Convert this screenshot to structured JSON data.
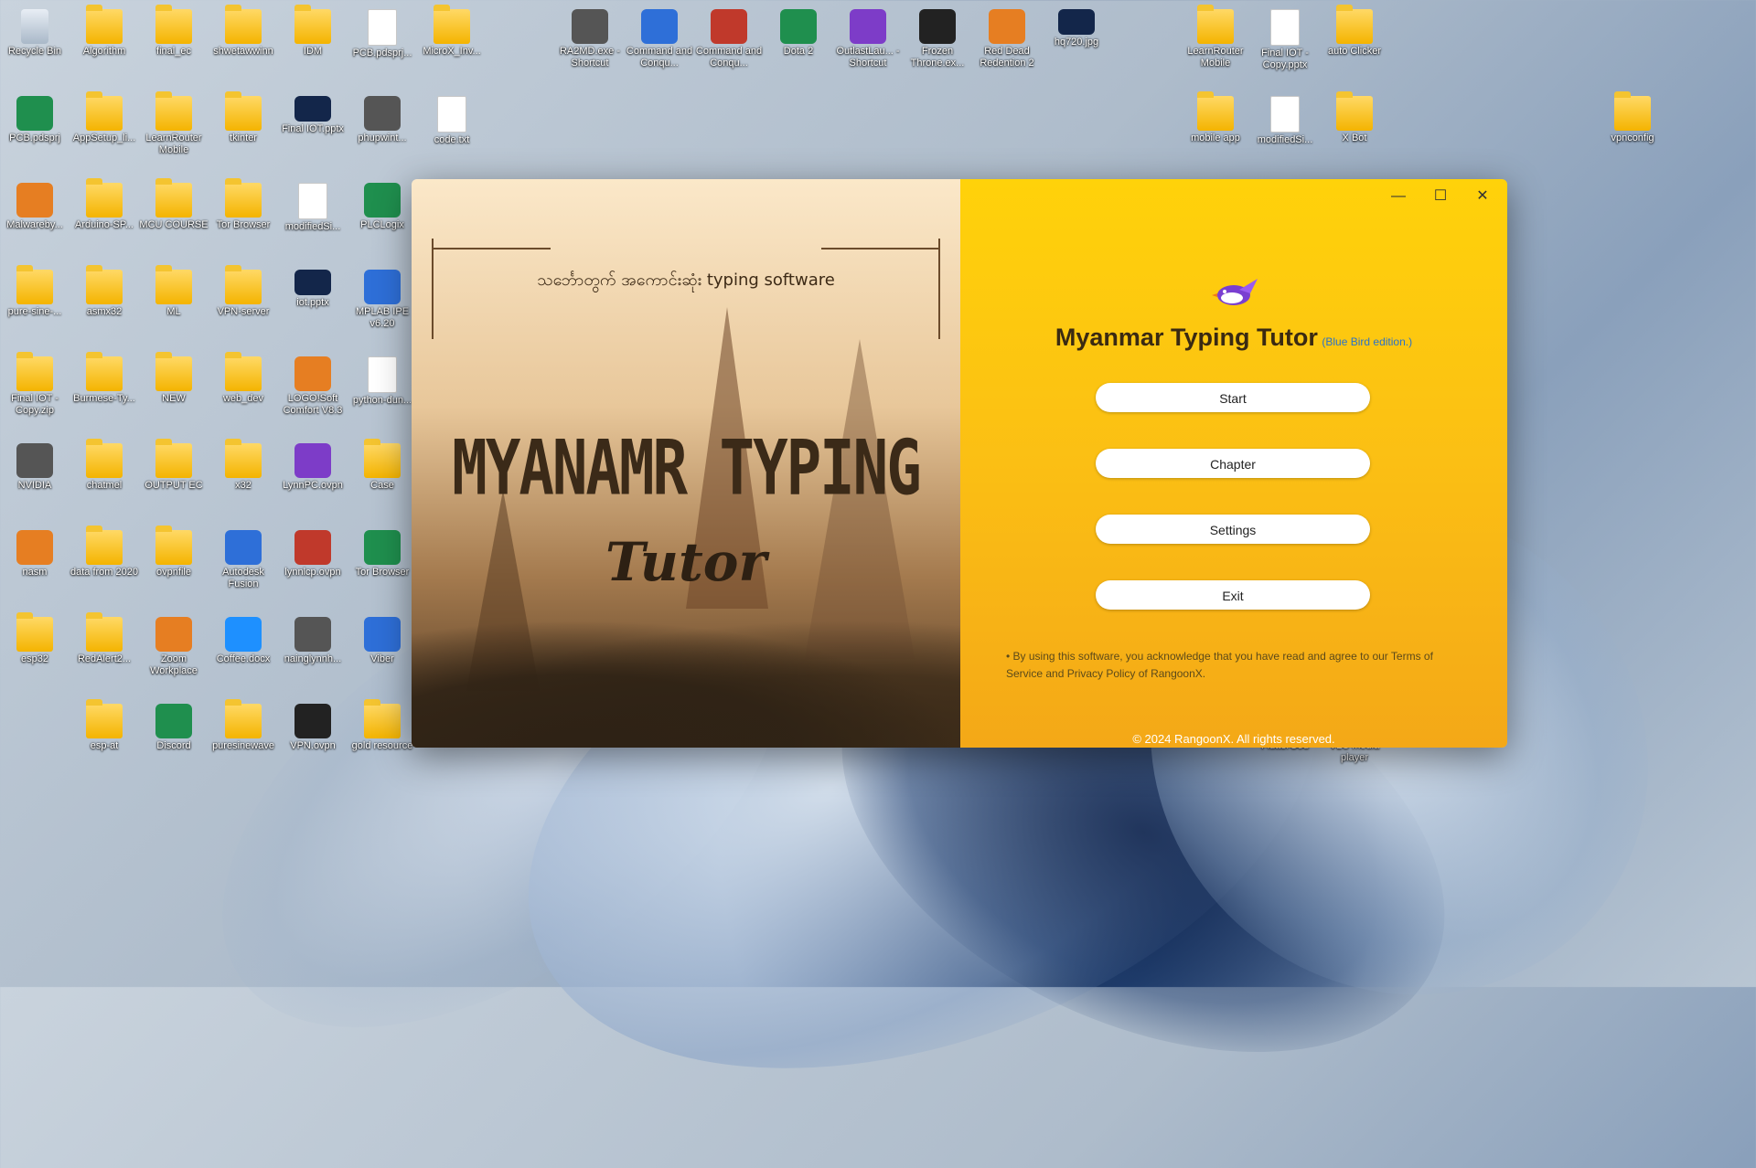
{
  "desktop": {
    "icons": [
      {
        "label": "Recycle Bin",
        "icon": "recycle-bin-icon"
      },
      {
        "label": "Algorithm",
        "icon": "folder-icon"
      },
      {
        "label": "final_ec",
        "icon": "folder-icon"
      },
      {
        "label": "shwetawwinn",
        "icon": "folder-icon"
      },
      {
        "label": "IDM",
        "icon": "folder-icon"
      },
      {
        "label": "PCB.pdsprj...",
        "icon": "file-icon"
      },
      {
        "label": "MicroX_Inv...",
        "icon": "folder-icon"
      },
      {
        "label": "RA2MD.exe - Shortcut",
        "icon": "app-icon"
      },
      {
        "label": "Command and Conqu...",
        "icon": "app-icon"
      },
      {
        "label": "Command and Conqu...",
        "icon": "app-icon"
      },
      {
        "label": "Dota 2",
        "icon": "app-icon"
      },
      {
        "label": "OutlastLau... - Shortcut",
        "icon": "app-icon"
      },
      {
        "label": "Frozen Throne.ex...",
        "icon": "app-icon"
      },
      {
        "label": "Red Dead Redention 2",
        "icon": "app-icon"
      },
      {
        "label": "hq720.jpg",
        "icon": "image-icon"
      },
      {
        "label": "LearnRouter Mobile",
        "icon": "folder-icon"
      },
      {
        "label": "Final IOT - Copy.pptx",
        "icon": "file-icon"
      },
      {
        "label": "auto Clicker",
        "icon": "folder-icon"
      },
      {
        "label": "PCB.pdsprj",
        "icon": "app-icon"
      },
      {
        "label": "AppSetup_li...",
        "icon": "folder-icon"
      },
      {
        "label": "LearnRouter Mobile",
        "icon": "folder-icon"
      },
      {
        "label": "tkinter",
        "icon": "folder-icon"
      },
      {
        "label": "Final IOT.pptx",
        "icon": "image-icon"
      },
      {
        "label": "phupwint...",
        "icon": "app-icon"
      },
      {
        "label": "code.txt",
        "icon": "file-icon"
      },
      {
        "label": "mobile app",
        "icon": "folder-icon"
      },
      {
        "label": "modifiedSi...",
        "icon": "file-icon"
      },
      {
        "label": "X Bot",
        "icon": "folder-icon"
      },
      {
        "label": "vpnconfig",
        "icon": "folder-icon"
      },
      {
        "label": "Malwareby...",
        "icon": "app-icon"
      },
      {
        "label": "Arduino-SP...",
        "icon": "folder-icon"
      },
      {
        "label": "MCU COURSE",
        "icon": "folder-icon"
      },
      {
        "label": "Tor Browser",
        "icon": "folder-icon"
      },
      {
        "label": "modifiedSi...",
        "icon": "file-icon"
      },
      {
        "label": "PLCLogix",
        "icon": "app-icon"
      },
      {
        "label": "pure-sine-...",
        "icon": "folder-icon"
      },
      {
        "label": "asmx32",
        "icon": "folder-icon"
      },
      {
        "label": "ML",
        "icon": "folder-icon"
      },
      {
        "label": "VPN-server",
        "icon": "folder-icon"
      },
      {
        "label": "iot.pptx",
        "icon": "image-icon"
      },
      {
        "label": "MPLAB IPE v6.20",
        "icon": "app-icon"
      },
      {
        "label": "Final IOT - Copy.zip",
        "icon": "folder-icon"
      },
      {
        "label": "Burmese-Ty...",
        "icon": "folder-icon"
      },
      {
        "label": "NEW",
        "icon": "folder-icon"
      },
      {
        "label": "web_dev",
        "icon": "folder-icon"
      },
      {
        "label": "LOGO!Soft Comfort V8.3",
        "icon": "app-icon"
      },
      {
        "label": "python-dun...",
        "icon": "file-icon"
      },
      {
        "label": "NVIDIA",
        "icon": "app-icon"
      },
      {
        "label": "chatmel",
        "icon": "folder-icon"
      },
      {
        "label": "OUTPUT EC",
        "icon": "folder-icon"
      },
      {
        "label": "x32",
        "icon": "folder-icon"
      },
      {
        "label": "LynnPC.ovpn",
        "icon": "app-icon"
      },
      {
        "label": "Case",
        "icon": "folder-icon"
      },
      {
        "label": "nasm",
        "icon": "app-icon"
      },
      {
        "label": "data from 2020",
        "icon": "folder-icon"
      },
      {
        "label": "ovpnfile",
        "icon": "folder-icon"
      },
      {
        "label": "Autodesk Fusion",
        "icon": "app-icon"
      },
      {
        "label": "lynnlcp.ovpn",
        "icon": "app-icon"
      },
      {
        "label": "Tor Browser",
        "icon": "app-icon"
      },
      {
        "label": "esp32",
        "icon": "folder-icon"
      },
      {
        "label": "RedAlert2...",
        "icon": "folder-icon"
      },
      {
        "label": "Zoom Workplace",
        "icon": "app-icon"
      },
      {
        "label": "Coffee.docx",
        "icon": "app-icon"
      },
      {
        "label": "nainglynnh...",
        "icon": "app-icon"
      },
      {
        "label": "Viber",
        "icon": "app-icon"
      },
      {
        "label": "esp-at",
        "icon": "folder-icon"
      },
      {
        "label": "Discord",
        "icon": "app-icon"
      },
      {
        "label": "puresinewave",
        "icon": "folder-icon"
      },
      {
        "label": "VPN.ovpn",
        "icon": "app-icon"
      },
      {
        "label": "gold resource",
        "icon": "folder-icon"
      },
      {
        "label": "FlutterGod",
        "icon": "folder-icon"
      },
      {
        "label": "VLC media player",
        "icon": "app-icon"
      }
    ]
  },
  "app": {
    "splash": {
      "subtitle": "သင်္ဘောတွက် အကောင်းဆုံး typing software",
      "title": "MYANAMR TYPING",
      "tutor": "Tutor"
    },
    "window_controls": {
      "minimize": "—",
      "maximize": "☐",
      "close": "✕"
    },
    "title": "Myanmar Typing Tutor",
    "edition": "(Blue Bird edition.)",
    "buttons": {
      "start": "Start",
      "chapter": "Chapter",
      "settings": "Settings",
      "exit": "Exit"
    },
    "notice": "• By using this software, you acknowledge that you have read and agree to our Terms of Service and Privacy Policy of RangoonX.",
    "copyright": "© 2024 RangoonX. All rights reserved."
  }
}
